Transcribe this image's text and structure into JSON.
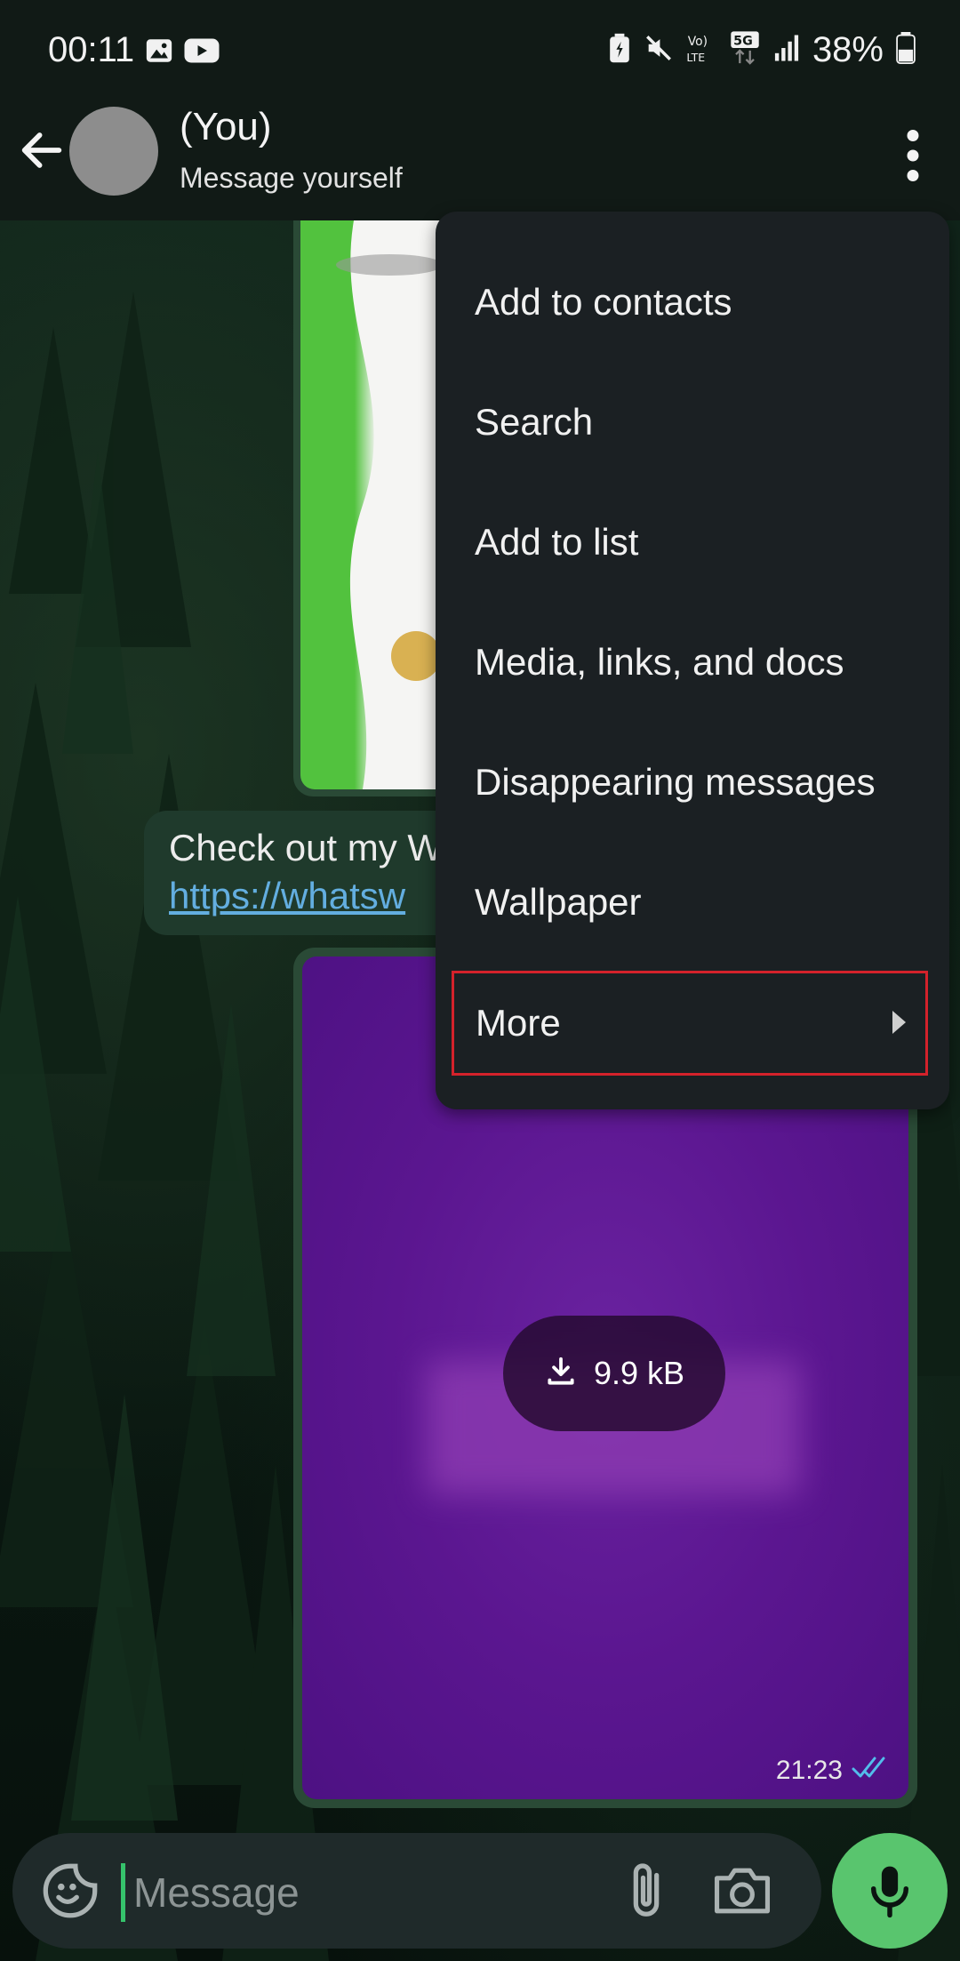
{
  "status_bar": {
    "time": "00:11",
    "battery": "38%",
    "network": "5G"
  },
  "header": {
    "name": "(You)",
    "subtitle": "Message yourself"
  },
  "chat": {
    "text_message": {
      "line1": "Check out my W",
      "link": "https://whatsw"
    },
    "media_message": {
      "size": "9.9 kB",
      "time": "21:23"
    }
  },
  "menu": {
    "items": [
      {
        "label": "Add to contacts"
      },
      {
        "label": "Search"
      },
      {
        "label": "Add to list"
      },
      {
        "label": "Media, links, and docs"
      },
      {
        "label": "Disappearing messages"
      },
      {
        "label": "Wallpaper"
      },
      {
        "label": "More"
      }
    ]
  },
  "composer": {
    "placeholder": "Message"
  },
  "colors": {
    "accent": "#59c56e",
    "highlight": "#d4222b",
    "link": "#63aee0"
  }
}
